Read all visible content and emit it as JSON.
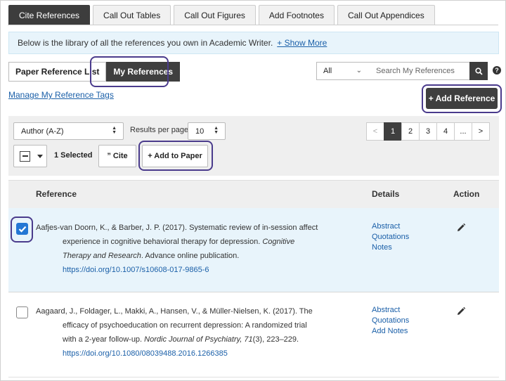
{
  "tabs": [
    "Cite References",
    "Call Out Tables",
    "Call Out Figures",
    "Add Footnotes",
    "Call Out Appendices"
  ],
  "banner": {
    "text": "Below is the library of all the references you own in Academic Writer.",
    "link": "+ Show More"
  },
  "toggle": {
    "paper_list": "Paper Reference List",
    "my_refs": "My References"
  },
  "search": {
    "filter": "All",
    "placeholder": "Search My References",
    "help": "?"
  },
  "manage_tags": "Manage My Reference Tags",
  "add_reference": "+ Add Reference",
  "controls": {
    "sort": "Author (A-Z)",
    "rpp_label": "Results per page",
    "rpp_value": "10",
    "pages": [
      "<",
      "1",
      "2",
      "3",
      "4",
      "...",
      ">"
    ],
    "selected": "1 Selected",
    "cite": "” Cite",
    "add_to_paper": "+ Add to Paper"
  },
  "table": {
    "headers": {
      "reference": "Reference",
      "details": "Details",
      "action": "Action"
    },
    "rows": [
      {
        "checked": true,
        "l1": "Aafjes-van Doorn, K., & Barber, J. P. (2017). Systematic review of in-session affect",
        "l2a": "experience in cognitive behavioral therapy for depression. ",
        "l2b": "Cognitive",
        "l3a": "Therapy and Research",
        "l3b": ". Advance online publication.",
        "doi": "https://doi.org/10.1007/s10608-017-9865-6",
        "details": [
          "Abstract",
          "Quotations",
          "Notes"
        ]
      },
      {
        "checked": false,
        "l1": "Aagaard, J., Foldager, L., Makki, A., Hansen, V., & Müller-Nielsen, K. (2017). The",
        "l2a": "efficacy of psychoeducation on recurrent depression: A randomized trial",
        "l3a": "with a 2-year follow-up. ",
        "l3b": "Nordic Journal of Psychiatry, 71",
        "l3c": "(3), 223–229.",
        "doi": "https://doi.org/10.1080/08039488.2016.1266385",
        "details": [
          "Abstract",
          "Quotations",
          "Add Notes"
        ]
      }
    ]
  }
}
